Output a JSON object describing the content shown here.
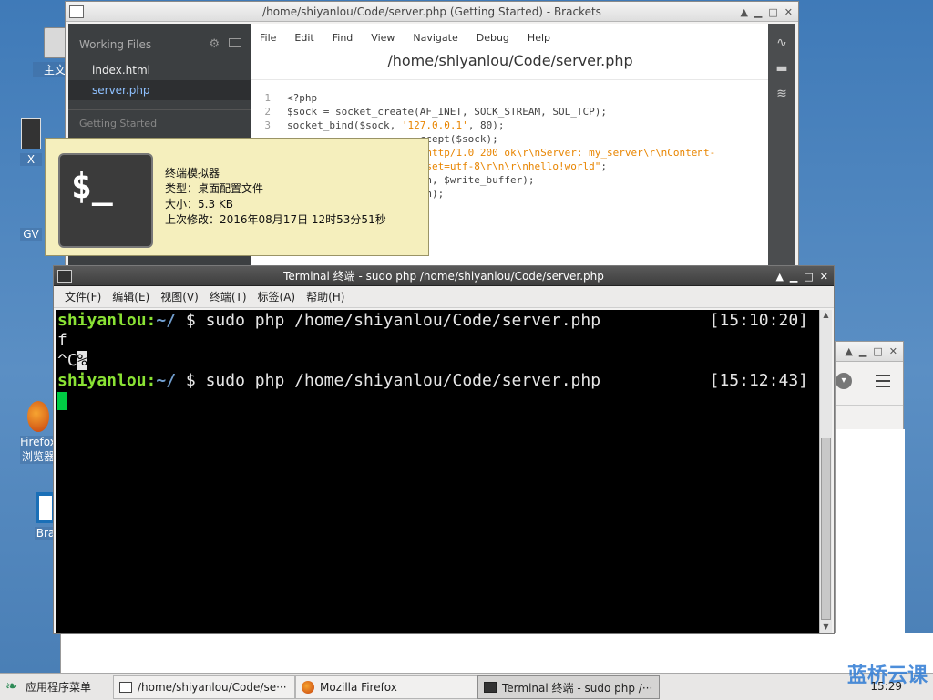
{
  "desktop": {
    "icons": [
      {
        "label": "主文件",
        "icon": "folder-icon"
      },
      {
        "label": "X",
        "icon": "terminal-icon"
      },
      {
        "label": "GV",
        "icon": "app-icon"
      },
      {
        "label": "Firefox 浏览器",
        "icon": "firefox-icon"
      },
      {
        "label": "Bra",
        "icon": "brackets-icon"
      }
    ]
  },
  "brackets": {
    "window_title": "/home/shiyanlou/Code/server.php (Getting Started) - Brackets",
    "sidebar": {
      "heading": "Working Files",
      "files": [
        "index.html",
        "server.php"
      ],
      "section": "Getting Started"
    },
    "menu": [
      "File",
      "Edit",
      "Find",
      "View",
      "Navigate",
      "Debug",
      "Help"
    ],
    "file_title": "/home/shiyanlou/Code/server.php",
    "code": [
      {
        "num": "1",
        "pre": "<?php",
        "str": "",
        "post": ""
      },
      {
        "num": "2",
        "pre": "$sock = socket_create(AF_INET, SOCK_STREAM, SOL_TCP);",
        "str": "",
        "post": ""
      },
      {
        "num": "3",
        "pre": "socket_bind($sock, ",
        "str": "'127.0.0.1'",
        "post": ", 80);"
      },
      {
        "num": "",
        "pre": "",
        "str": "",
        "post": ""
      },
      {
        "num": "",
        "pre": "",
        "str": "",
        "post": ""
      },
      {
        "num": "",
        "pre": "",
        "str": "",
        "post": ""
      },
      {
        "num": "",
        "pre": "                      ccept($sock);",
        "str": "",
        "post": ""
      },
      {
        "num": "",
        "pre": "                      ",
        "str": "\"http/1.0 200 ok\\r\\nServer: my_server\\r\\nContent-",
        "post": ""
      },
      {
        "num": "",
        "pre": "                      ",
        "str": "rset=utf-8\\r\\n\\r\\nhello!world\"",
        "post": ";"
      },
      {
        "num": "",
        "pre": "                      nn, $write_buffer);",
        "str": "",
        "post": ""
      },
      {
        "num": "",
        "pre": "                      nn);",
        "str": "",
        "post": ""
      }
    ]
  },
  "tooltip": {
    "icon_text": "$_",
    "name": "终端模拟器",
    "type": "类型：桌面配置文件",
    "size": "大小：5.3 KB",
    "modified": "上次修改：2016年08月17日 12时53分51秒"
  },
  "terminal": {
    "window_title": "Terminal 终端 - sudo php /home/shiyanlou/Code/server.php",
    "menu": [
      "文件(F)",
      "编辑(E)",
      "视图(V)",
      "终端(T)",
      "标签(A)",
      "帮助(H)"
    ],
    "lines": {
      "l1_user": "shiyanlou",
      "l1_sep": ":",
      "l1_path": "~/",
      "l1_cmd": " $ sudo php /home/shiyanlou/Code/server.php",
      "l1_time": "[15:10:20]",
      "l2": "f",
      "l3_pre": "^C",
      "l3_hl": "%",
      "l4_user": "shiyanlou",
      "l4_sep": ":",
      "l4_path": "~/",
      "l4_cmd": " $ sudo php /home/shiyanlou/Code/server.php",
      "l4_time": "[15:12:43]"
    }
  },
  "taskbar": {
    "start_label": "应用程序菜单",
    "tasks": [
      "/home/shiyanlou/Code/se···",
      "Mozilla Firefox",
      "Terminal 终端 - sudo php /···"
    ],
    "clock": "15:29",
    "watermark": "蓝桥云课"
  }
}
